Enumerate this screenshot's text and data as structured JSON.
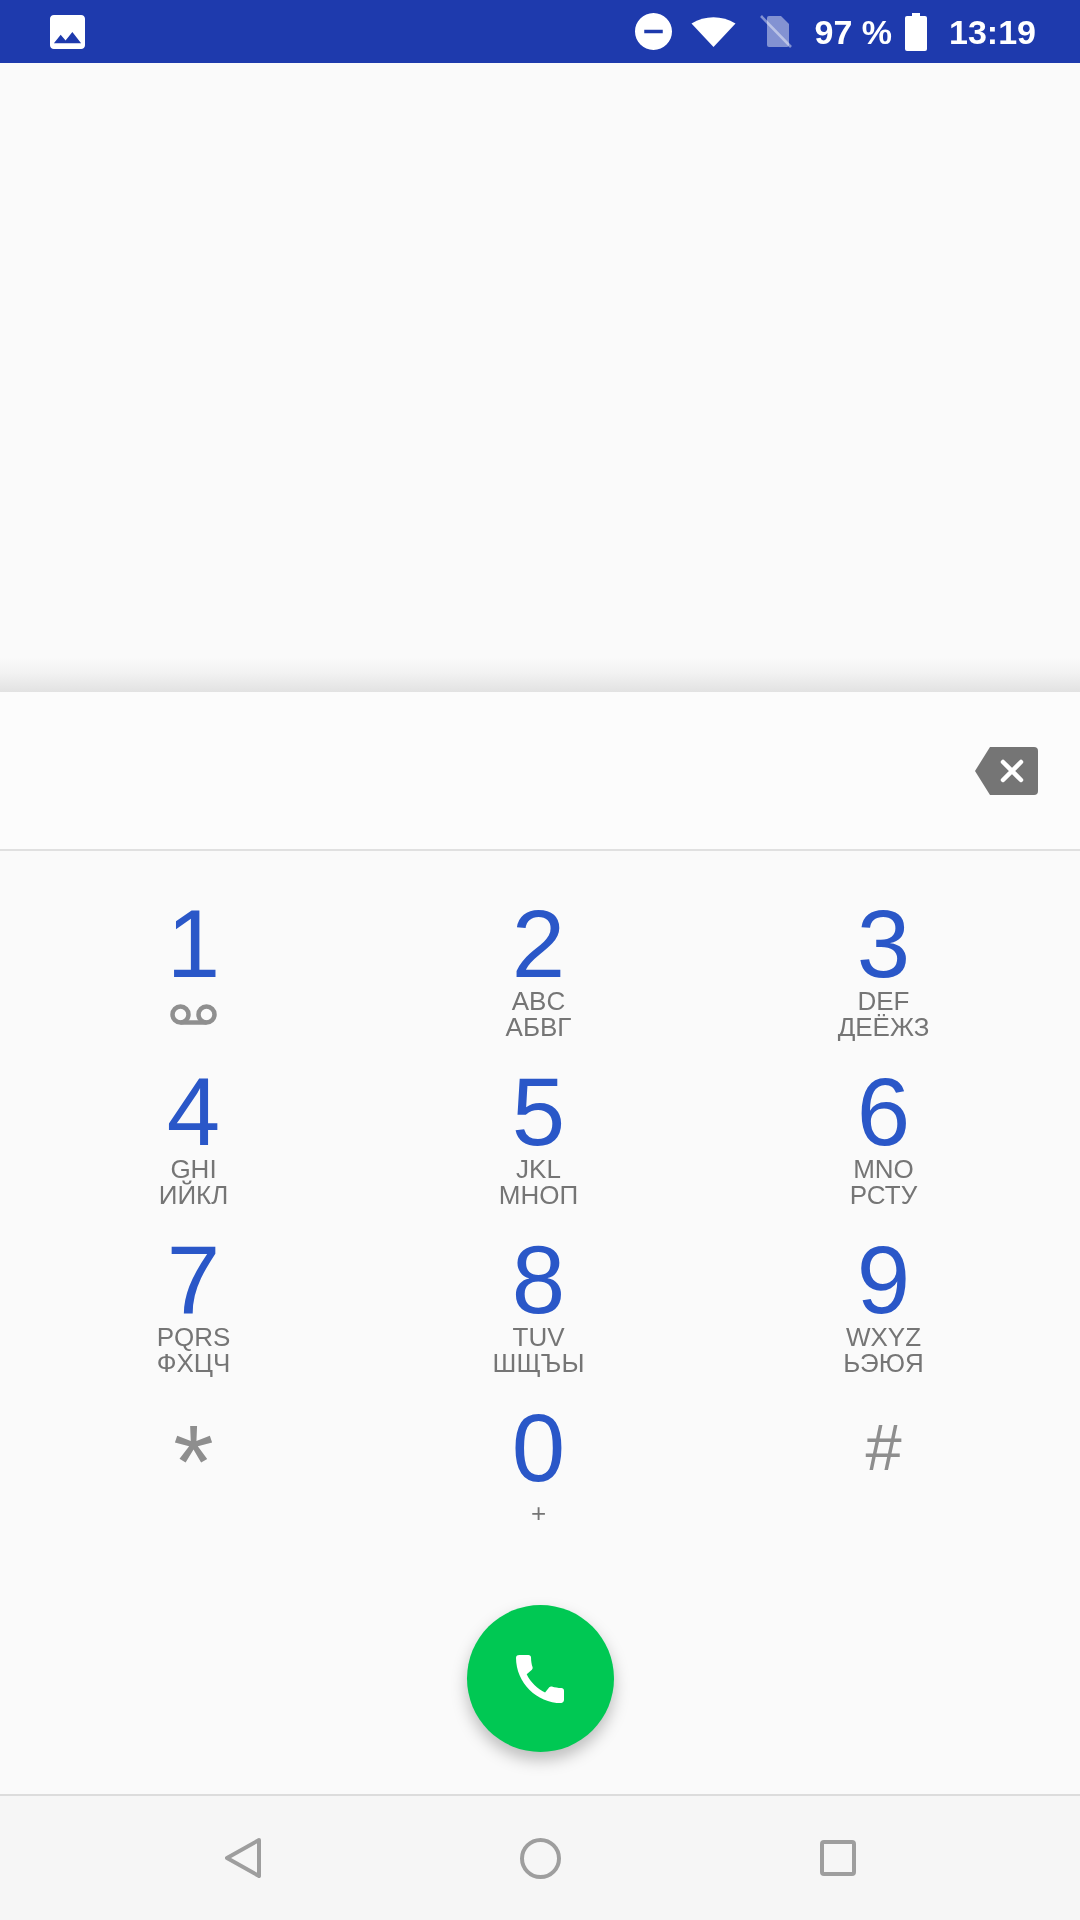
{
  "status_bar": {
    "battery": "97 %",
    "time": "13:19"
  },
  "dialpad": {
    "keys": [
      {
        "kind": "voicemail",
        "label": "1"
      },
      {
        "kind": "letters",
        "label": "2",
        "letters": [
          "ABC",
          "АБВГ"
        ]
      },
      {
        "kind": "letters",
        "label": "3",
        "letters": [
          "DEF",
          "ДЕЁЖЗ"
        ]
      },
      {
        "kind": "letters",
        "label": "4",
        "letters": [
          "GHI",
          "ИЙКЛ"
        ]
      },
      {
        "kind": "letters",
        "label": "5",
        "letters": [
          "JKL",
          "МНОП"
        ]
      },
      {
        "kind": "letters",
        "label": "6",
        "letters": [
          "MNO",
          "РСТУ"
        ]
      },
      {
        "kind": "letters",
        "label": "7",
        "letters": [
          "PQRS",
          "ФХЦЧ"
        ]
      },
      {
        "kind": "letters",
        "label": "8",
        "letters": [
          "TUV",
          "ШЩЪЫ"
        ]
      },
      {
        "kind": "letters",
        "label": "9",
        "letters": [
          "WXYZ",
          "ЬЭЮЯ"
        ]
      },
      {
        "kind": "star",
        "label": "*"
      },
      {
        "kind": "plus",
        "label": "0",
        "letters": [
          "+"
        ]
      },
      {
        "kind": "hash",
        "label": "#"
      }
    ]
  }
}
